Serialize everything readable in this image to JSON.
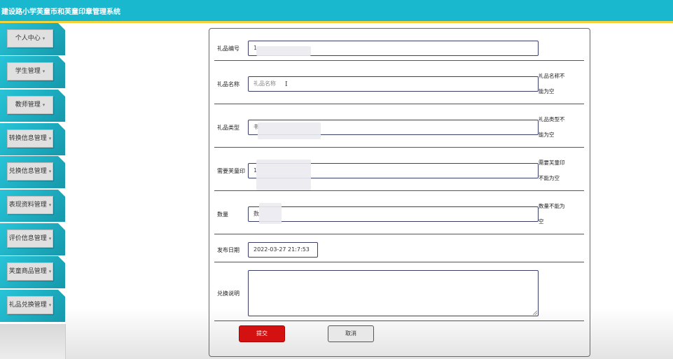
{
  "header": {
    "title": "建设路小学芙童币和芙童印章管理系统"
  },
  "sidebar": {
    "items": [
      {
        "label": "个人中心"
      },
      {
        "label": "学生管理"
      },
      {
        "label": "教师管理"
      },
      {
        "label": "转换信息管理"
      },
      {
        "label": "兑换信息管理"
      },
      {
        "label": "表现资料管理"
      },
      {
        "label": "评价信息管理"
      },
      {
        "label": "芙童商品管理"
      },
      {
        "label": "礼品兑换管理"
      }
    ],
    "caret": "▾"
  },
  "form": {
    "gift_id": {
      "label": "礼品编号",
      "value": "1"
    },
    "gift_name": {
      "label": "礼品名称",
      "placeholder": "礼品名称",
      "error": "礼品名称不能为空"
    },
    "gift_type": {
      "label": "礼品类型",
      "value": "书",
      "error": "礼品类型不能为空"
    },
    "stamps_needed": {
      "label": "需要芙童印",
      "value": "1",
      "error": "需要芙童印不能为空"
    },
    "quantity": {
      "label": "数量",
      "value": "数",
      "error": "数量不能为空"
    },
    "publish_date": {
      "label": "发布日期",
      "value": "2022-03-27 21:7:53"
    },
    "description": {
      "label": "兑换说明",
      "value": ""
    }
  },
  "actions": {
    "submit": "提交",
    "cancel": "取消"
  },
  "colors": {
    "header": "#1ab8cf",
    "header_border": "#f2d43a",
    "sidebar": "#1aa6b8",
    "submit": "#d41111"
  }
}
